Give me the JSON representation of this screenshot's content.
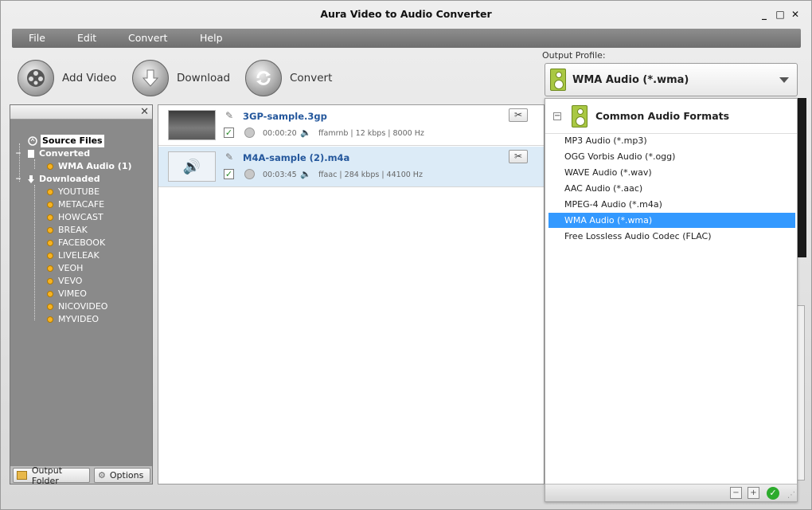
{
  "window": {
    "title": "Aura Video to Audio Converter",
    "controls": [
      "_",
      "□",
      "✕"
    ]
  },
  "menu": [
    "File",
    "Edit",
    "Convert",
    "Help"
  ],
  "toolbar": {
    "add_video": "Add Video",
    "download": "Download",
    "convert": "Convert"
  },
  "output_profile": {
    "label": "Output Profile:",
    "value": "WMA Audio (*.wma)"
  },
  "tree": {
    "source_files": "Source Files",
    "converted": "Converted",
    "converted_children": [
      "WMA Audio (1)"
    ],
    "downloaded": "Downloaded",
    "downloaded_children": [
      "YOUTUBE",
      "METACAFE",
      "HOWCAST",
      "BREAK",
      "FACEBOOK",
      "LIVELEAK",
      "VEOH",
      "VEVO",
      "VIMEO",
      "NICOVIDEO",
      "MYVIDEO"
    ]
  },
  "left_footer": {
    "output_folder": "Output Folder",
    "options": "Options"
  },
  "files": [
    {
      "name": "3GP-sample.3gp",
      "duration": "00:00:20",
      "audio": "ffamrnb | 12 kbps | 8000 Hz"
    },
    {
      "name": "M4A-sample (2).m4a",
      "duration": "00:03:45",
      "audio": "ffaac | 284 kbps | 44100 Hz"
    }
  ],
  "dropdown": {
    "group": "Common Audio Formats",
    "items": [
      "MP3 Audio (*.mp3)",
      "OGG Vorbis Audio (*.ogg)",
      "WAVE Audio (*.wav)",
      "AAC Audio (*.aac)",
      "MPEG-4 Audio (*.m4a)",
      "WMA Audio (*.wma)",
      "Free Lossless Audio Codec (FLAC)"
    ],
    "selected_index": 5
  },
  "colors": {
    "selection": "#3399ff",
    "menubar": "#7f7f7f",
    "tree_panel": "#8a8a8a",
    "file_link": "#24579c"
  }
}
